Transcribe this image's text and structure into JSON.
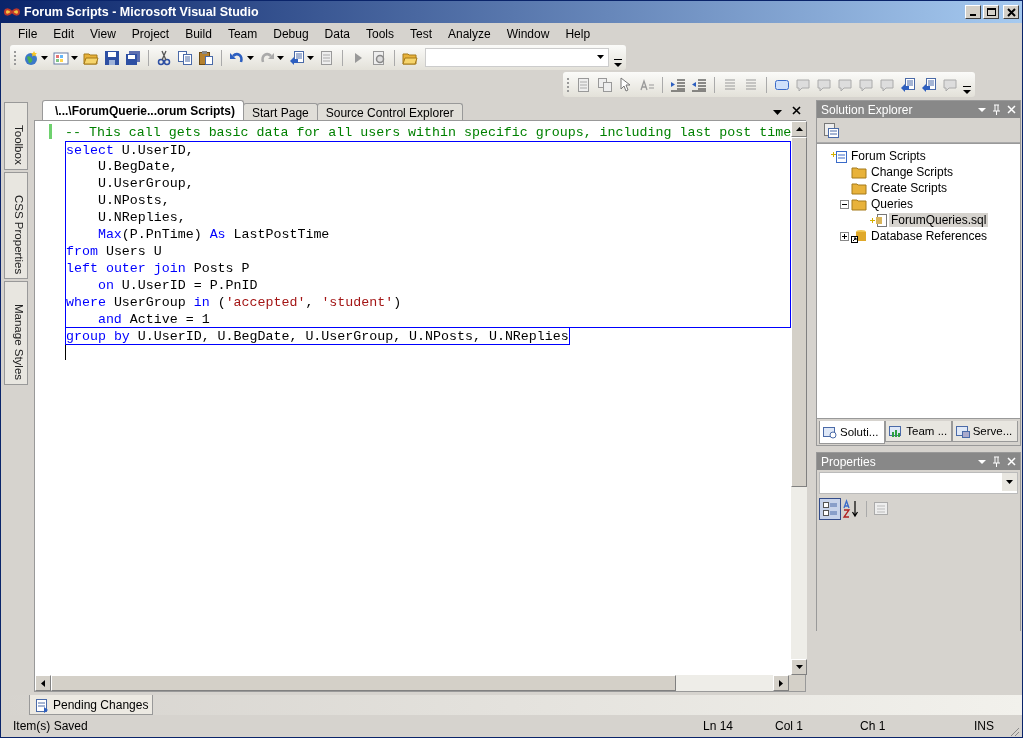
{
  "window": {
    "title": "Forum Scripts - Microsoft Visual Studio"
  },
  "menu": [
    "File",
    "Edit",
    "View",
    "Project",
    "Build",
    "Team",
    "Debug",
    "Data",
    "Tools",
    "Test",
    "Analyze",
    "Window",
    "Help"
  ],
  "side_tabs": [
    "Toolbox",
    "CSS Properties",
    "Manage Styles"
  ],
  "document_tabs": [
    {
      "label": "\\...\\ForumQuerie...orum Scripts)",
      "selected": true
    },
    {
      "label": "Start Page",
      "selected": false
    },
    {
      "label": "Source Control Explorer",
      "selected": false
    }
  ],
  "editor": {
    "lines": [
      {
        "outlined": false,
        "tokens": [
          {
            "kind": "comment",
            "text": "-- This call gets basic data for all users within specific groups, including last post time"
          }
        ]
      },
      {
        "outlined": true,
        "tokens": [
          {
            "kind": "keyword",
            "text": "select"
          },
          {
            "kind": "plain",
            "text": " U.UserID,"
          }
        ]
      },
      {
        "outlined": true,
        "indented": true,
        "tokens": [
          {
            "kind": "plain",
            "text": "U.BegDate,"
          }
        ]
      },
      {
        "outlined": true,
        "indented": true,
        "tokens": [
          {
            "kind": "plain",
            "text": "U.UserGroup,"
          }
        ]
      },
      {
        "outlined": true,
        "indented": true,
        "tokens": [
          {
            "kind": "plain",
            "text": "U.NPosts,"
          }
        ]
      },
      {
        "outlined": true,
        "indented": true,
        "tokens": [
          {
            "kind": "plain",
            "text": "U.NReplies,"
          }
        ]
      },
      {
        "outlined": true,
        "indented": true,
        "tokens": [
          {
            "kind": "keyword",
            "text": "Max"
          },
          {
            "kind": "plain",
            "text": "(P.PnTime) "
          },
          {
            "kind": "keyword",
            "text": "As"
          },
          {
            "kind": "plain",
            "text": " LastPostTime"
          }
        ]
      },
      {
        "outlined": true,
        "tokens": [
          {
            "kind": "keyword",
            "text": "from"
          },
          {
            "kind": "plain",
            "text": " Users U"
          }
        ]
      },
      {
        "outlined": true,
        "tokens": [
          {
            "kind": "keyword",
            "text": "left outer join"
          },
          {
            "kind": "plain",
            "text": " Posts P"
          }
        ]
      },
      {
        "outlined": true,
        "indented": true,
        "tokens": [
          {
            "kind": "keyword",
            "text": "on"
          },
          {
            "kind": "plain",
            "text": " U.UserID = P.PnID"
          }
        ]
      },
      {
        "outlined": true,
        "tokens": [
          {
            "kind": "keyword",
            "text": "where"
          },
          {
            "kind": "plain",
            "text": " UserGroup "
          },
          {
            "kind": "keyword",
            "text": "in"
          },
          {
            "kind": "plain",
            "text": " ("
          },
          {
            "kind": "string",
            "text": "'accepted'"
          },
          {
            "kind": "plain",
            "text": ", "
          },
          {
            "kind": "string",
            "text": "'student'"
          },
          {
            "kind": "plain",
            "text": ")"
          }
        ]
      },
      {
        "outlined": true,
        "indented": true,
        "tokens": [
          {
            "kind": "keyword",
            "text": "and"
          },
          {
            "kind": "plain",
            "text": " Active = 1"
          }
        ]
      },
      {
        "outlined": true,
        "tokens": [
          {
            "kind": "keyword",
            "text": "group by"
          },
          {
            "kind": "plain",
            "text": " U.UserID, U.BegDate, U.UserGroup, U.NPosts, U.NReplies"
          }
        ]
      }
    ]
  },
  "solution_explorer": {
    "title": "Solution Explorer",
    "tree": [
      {
        "label": "Forum Scripts",
        "kind": "project",
        "selected": false,
        "children": [
          {
            "label": "Change Scripts",
            "kind": "folder",
            "selected": false
          },
          {
            "label": "Create Scripts",
            "kind": "folder",
            "selected": false
          },
          {
            "label": "Queries",
            "kind": "folder",
            "selected": false,
            "expanded": true,
            "children": [
              {
                "label": "ForumQueries.sql",
                "kind": "file",
                "selected": true
              }
            ]
          },
          {
            "label": "Database References",
            "kind": "reference",
            "selected": false,
            "expanded": false
          }
        ]
      }
    ],
    "tabs": [
      {
        "label": "Soluti...",
        "selected": true
      },
      {
        "label": "Team ...",
        "selected": false
      },
      {
        "label": "Serve...",
        "selected": false
      }
    ]
  },
  "properties": {
    "title": "Properties"
  },
  "bottom_tabs": [
    {
      "label": "Pending Changes"
    }
  ],
  "status_bar": {
    "message": "Item(s) Saved",
    "line": "Ln 14",
    "column": "Col 1",
    "char": "Ch 1",
    "mode": "INS"
  }
}
